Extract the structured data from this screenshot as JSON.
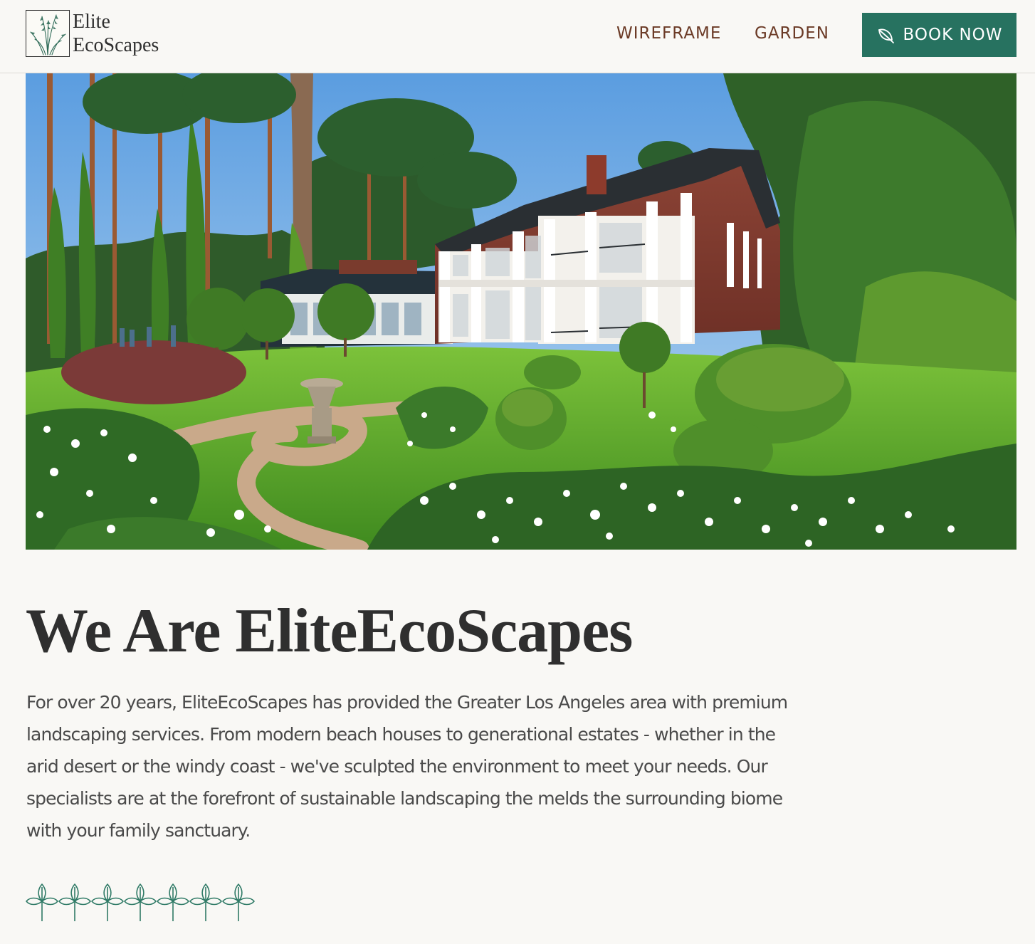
{
  "brand": {
    "name_line1": "Elite",
    "name_line2": "EcoScapes",
    "logo_icon": "reed-grass-icon"
  },
  "nav": {
    "items": [
      {
        "label": "WIREFRAME"
      },
      {
        "label": "GARDEN"
      }
    ],
    "cta": {
      "label": "BOOK NOW",
      "icon": "leaf-icon"
    }
  },
  "hero": {
    "image_subject": "estate garden with mansion, pine trees, lawn, stone path and white roses"
  },
  "content": {
    "title": "We Are EliteEcoScapes",
    "body": "For over 20 years, EliteEcoScapes has provided the Greater Los Angeles area with premium landscaping services. From modern beach houses to generational estates - whether in the arid desert or the windy coast - we've sculpted the environment to meet your needs. Our specialists are at the forefront of sustainable landscaping the melds the surrounding biome with your family sanctuary."
  },
  "divider": {
    "icon": "leaf-ornament-icon",
    "count": 7
  },
  "colors": {
    "accent": "#277260",
    "nav_text": "#6b3a26",
    "background": "#f9f8f5",
    "heading": "#2f2f2f",
    "body_text": "#4a4a4a"
  }
}
